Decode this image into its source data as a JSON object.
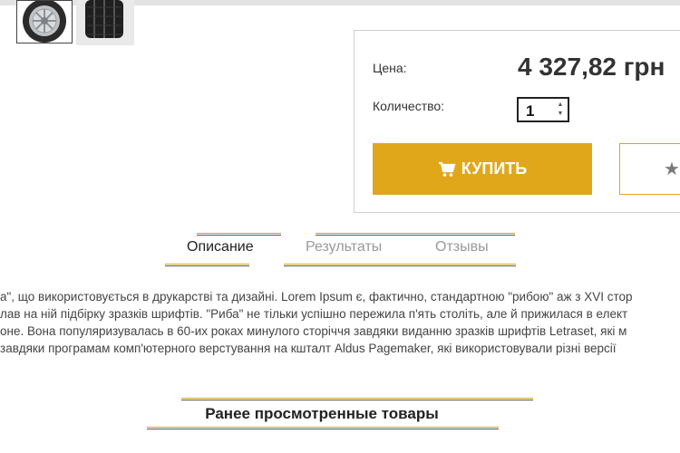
{
  "gallery": {
    "thumbnails": [
      {
        "name": "tire-side-view",
        "selected": true
      },
      {
        "name": "tire-tread-view",
        "selected": false
      }
    ]
  },
  "buy_box": {
    "price_label": "Цена:",
    "price_value": "4 327,82 грн",
    "quantity_label": "Количество:",
    "quantity_value": "1",
    "buy_button_label": "КУПИТЬ",
    "buy_icon": "cart-icon",
    "wishlist_icon": "star-icon"
  },
  "tabs": [
    {
      "label": "Описание",
      "active": true
    },
    {
      "label": "Результаты",
      "active": false
    },
    {
      "label": "Отзывы",
      "active": false
    }
  ],
  "description": {
    "lines": [
      "а\", що використовується в друкарстві та дизайні. Lorem Ipsum є, фактично, стандартною \"рибою\" аж з XVI стор",
      "лав на ній підбірку зразків шрифтів. \"Риба\" не тільки успішно пережила п'ять століть, але й прижилася в елект",
      "оне. Вона популяризувалась в 60-их роках минулого сторіччя завдяки виданню зразків шрифтів Letraset, які м",
      "завдяки програмам комп'ютерного верстування на кшталт Aldus Pagemaker, які використовували різні версії"
    ]
  },
  "recently_viewed": {
    "title": "Ранее просмотренные товары"
  },
  "colors": {
    "accent": "#e0a71a",
    "border": "#cfcfcf",
    "text": "#333333",
    "muted_tab": "#999999"
  }
}
